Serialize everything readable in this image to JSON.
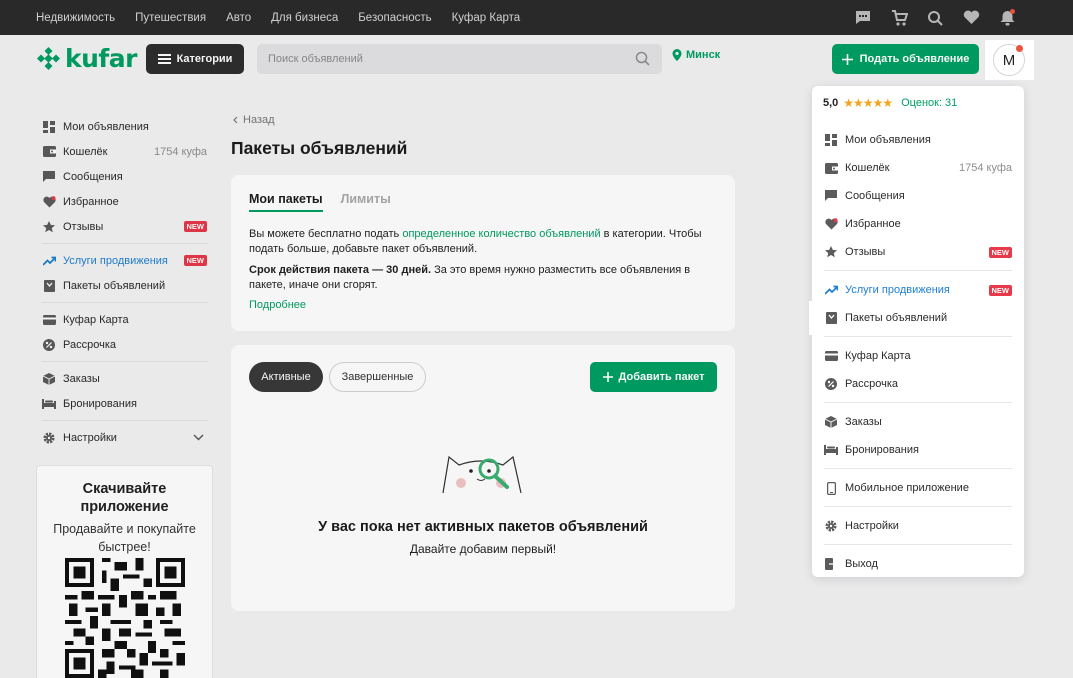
{
  "topbar": {
    "links": [
      "Недвижимость",
      "Путешествия",
      "Авто",
      "Для бизнеса",
      "Безопасность",
      "Куфар Карта"
    ]
  },
  "header": {
    "logo": "kufar",
    "categories_label": "Категории",
    "search_placeholder": "Поиск объявлений",
    "city": "Минск",
    "post_label": "Подать объявление",
    "avatar_letter": "M"
  },
  "sidebar": {
    "items": [
      {
        "label": "Мои объявления",
        "icon": "grid-icon"
      },
      {
        "label": "Кошелёк",
        "aside": "1754 куфа",
        "icon": "wallet-icon"
      },
      {
        "label": "Сообщения",
        "icon": "chat-icon"
      },
      {
        "label": "Избранное",
        "icon": "heart-icon"
      },
      {
        "label": "Отзывы",
        "badge": "NEW",
        "icon": "star-icon"
      },
      {
        "label": "Услуги продвижения",
        "badge": "NEW",
        "icon": "trend-icon"
      },
      {
        "label": "Пакеты объявлений",
        "icon": "package-icon"
      },
      {
        "label": "Куфар Карта",
        "icon": "card-icon"
      },
      {
        "label": "Рассрочка",
        "icon": "installment-icon"
      },
      {
        "label": "Заказы",
        "icon": "box-icon"
      },
      {
        "label": "Бронирования",
        "icon": "bed-icon"
      },
      {
        "label": "Настройки",
        "icon": "gear-icon"
      }
    ],
    "app_card": {
      "title": "Скачивайте приложение",
      "subtitle": "Продавайте и покупайте быстрее!"
    }
  },
  "main": {
    "back": "Назад",
    "title": "Пакеты объявлений",
    "tabs": [
      "Мои пакеты",
      "Лимиты"
    ],
    "info": {
      "p1_pre": "Вы можете бесплатно подать ",
      "p1_link": "определенное количество объявлений",
      "p1_post": " в категории. Чтобы подать больше, добавьте пакет объявлений.",
      "p2_bold": "Срок действия пакета — 30 дней.",
      "p2_rest": " За это время нужно разместить все объявления в пакете, иначе они сгорят.",
      "more": "Подробнее"
    },
    "filters": [
      "Активные",
      "Завершенные"
    ],
    "add_label": "Добавить пакет",
    "empty_title": "У вас пока нет активных пакетов объявлений",
    "empty_sub": "Давайте добавим первый!"
  },
  "dropdown": {
    "score": "5,0",
    "stars": "★★★★★",
    "ratings": "Оценок: 31",
    "items": [
      {
        "label": "Мои объявления"
      },
      {
        "label": "Кошелёк",
        "aside": "1754 куфа"
      },
      {
        "label": "Сообщения"
      },
      {
        "label": "Избранное"
      },
      {
        "label": "Отзывы",
        "badge": "NEW"
      },
      {
        "label": "Услуги продвижения",
        "badge": "NEW"
      },
      {
        "label": "Пакеты объявлений"
      },
      {
        "label": "Куфар Карта"
      },
      {
        "label": "Рассрочка"
      },
      {
        "label": "Заказы"
      },
      {
        "label": "Бронирования"
      },
      {
        "label": "Мобильное приложение"
      },
      {
        "label": "Настройки"
      },
      {
        "label": "Выход"
      }
    ]
  },
  "colors": {
    "brand": "#009f64",
    "accent_link": "#1f7fd1",
    "badge": "#e8394a",
    "dark": "#2b2b2b"
  }
}
